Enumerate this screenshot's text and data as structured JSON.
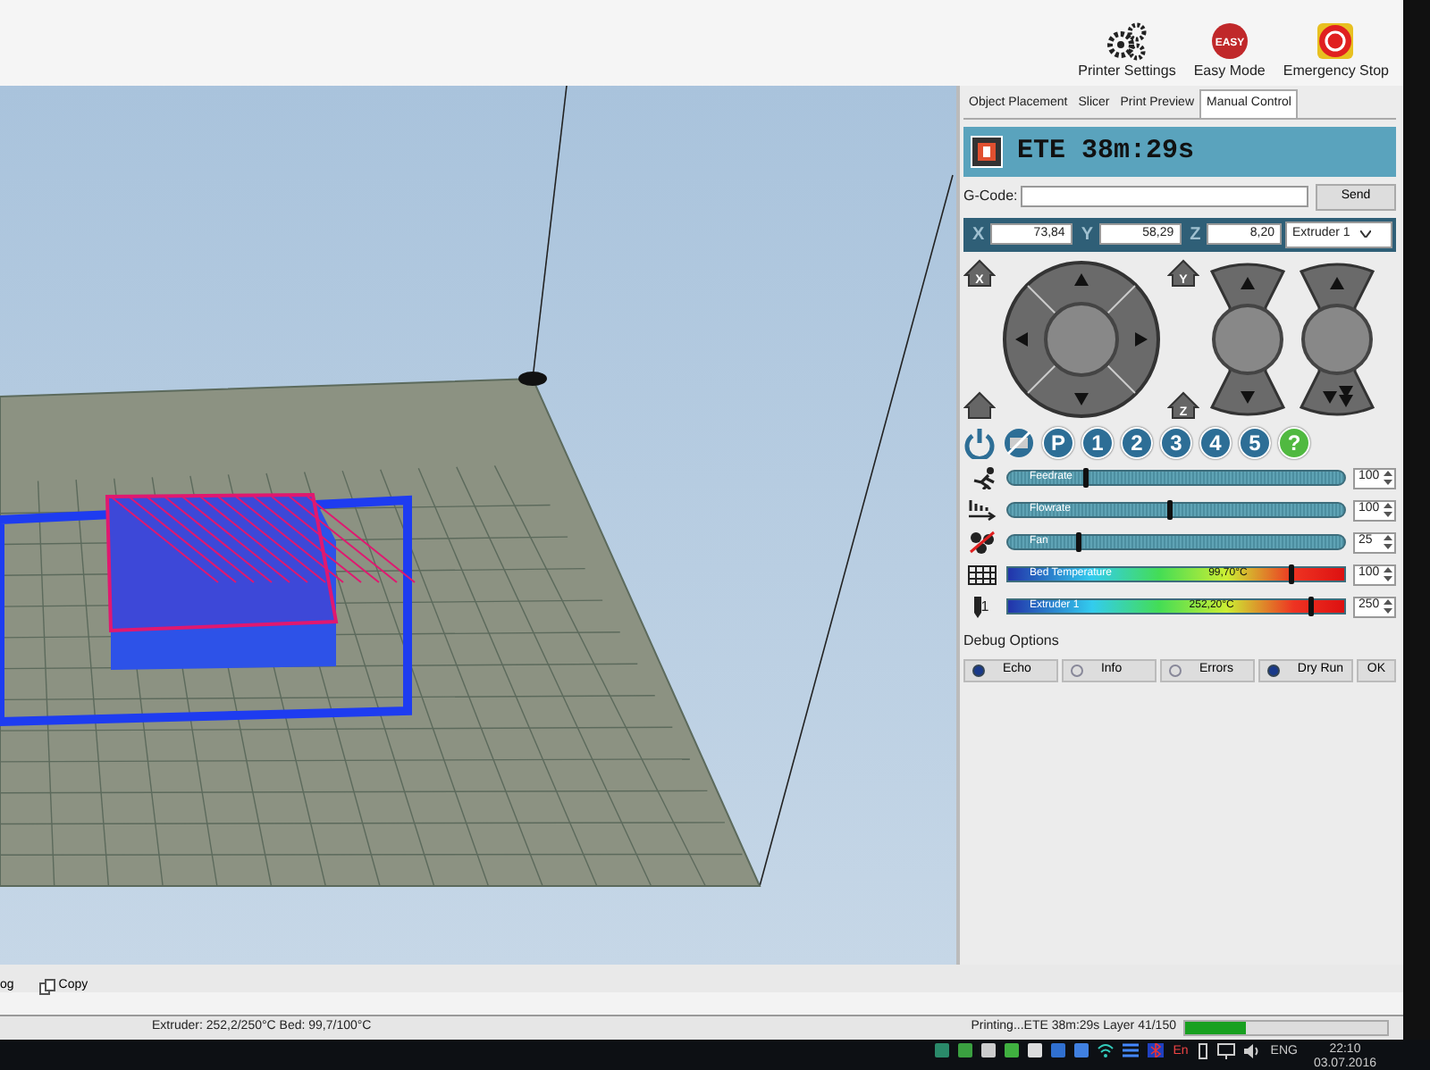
{
  "toolbar": {
    "buttons": [
      {
        "kind": "gears",
        "label": "Printer Settings"
      },
      {
        "kind": "easy",
        "label": "Easy Mode",
        "badge": "EASY"
      },
      {
        "kind": "stop",
        "label": "Emergency Stop"
      }
    ]
  },
  "tabs": [
    {
      "label": "Object Placement",
      "selected": false
    },
    {
      "label": "Slicer",
      "selected": false
    },
    {
      "label": "Print Preview",
      "selected": false
    },
    {
      "label": "Manual Control",
      "selected": true
    }
  ],
  "eta": "ETE 38m:29s",
  "gcode": {
    "label": "G-Code:",
    "button": "Send"
  },
  "coordinates": [
    {
      "axis": "X",
      "value": "73,84"
    },
    {
      "axis": "Y",
      "value": "58,29"
    },
    {
      "axis": "Z",
      "value": "8,20"
    }
  ],
  "extruder_select": "Extruder 1",
  "home_labels": {
    "top_left": "X",
    "top_right": "Y",
    "bottom_right": "Z"
  },
  "quick_buttons": [
    {
      "kind": "power"
    },
    {
      "kind": "motor"
    },
    {
      "kind": "text",
      "label": "P"
    },
    {
      "kind": "text",
      "label": "1"
    },
    {
      "kind": "text",
      "label": "2"
    },
    {
      "kind": "text",
      "label": "3"
    },
    {
      "kind": "text",
      "label": "4"
    },
    {
      "kind": "text",
      "label": "5"
    },
    {
      "kind": "help",
      "label": "?"
    }
  ],
  "sliders": [
    {
      "kind": "rate",
      "label": "Feedrate",
      "level": 0.23,
      "value": "100"
    },
    {
      "kind": "rate",
      "label": "Flowrate",
      "level": 0.48,
      "value": "100"
    },
    {
      "kind": "rate",
      "label": "Fan",
      "level": 0.21,
      "value": "25"
    },
    {
      "kind": "temperature",
      "label": "Bed Temperature",
      "reading": "99,70°C",
      "level": 0.84,
      "value": "100"
    },
    {
      "kind": "temperature",
      "icon_label": "1",
      "label": "Extruder 1",
      "reading": "252,20°C",
      "level": 0.9,
      "value": "250"
    }
  ],
  "debug": {
    "title": "Debug Options",
    "options": [
      {
        "label": "Echo",
        "checked": true
      },
      {
        "label": "Info",
        "checked": false
      },
      {
        "label": "Errors",
        "checked": false
      },
      {
        "label": "Dry Run",
        "checked": true
      }
    ],
    "ok": "OK"
  },
  "log_bar": {
    "buttons": [
      "og",
      "Copy"
    ]
  },
  "status_bar": {
    "temperatures": "Extruder: 252,2/250°C Bed: 99,7/100°C",
    "progress_text": "Printing...ETE 38m:29s Layer 41/150",
    "level": 0.3
  },
  "taskbar": {
    "language_short": "En",
    "language": "ENG",
    "time": "22:10",
    "date": "03.07.2016"
  }
}
